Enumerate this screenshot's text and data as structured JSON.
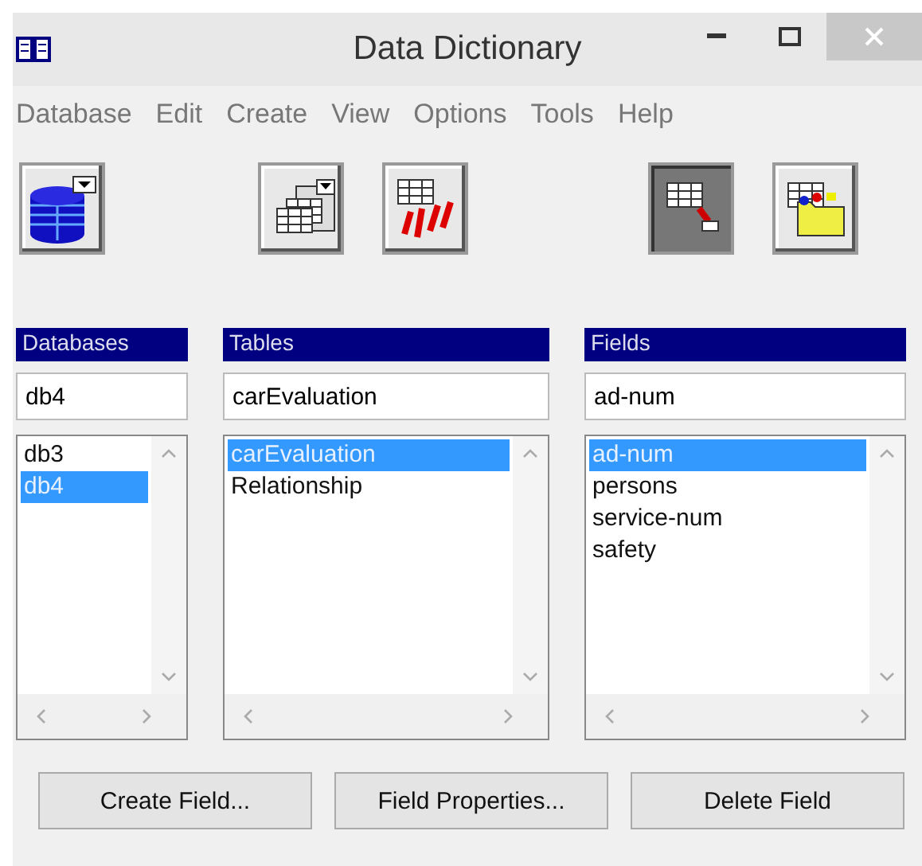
{
  "window": {
    "title": "Data Dictionary"
  },
  "menu": [
    "Database",
    "Edit",
    "Create",
    "View",
    "Options",
    "Tools",
    "Help"
  ],
  "toolbar": [
    [
      {
        "kind": "database",
        "pressed": false
      }
    ],
    [
      {
        "kind": "tables",
        "pressed": false
      },
      {
        "kind": "numbers",
        "pressed": false
      }
    ],
    [
      {
        "kind": "grid-link",
        "pressed": true
      },
      {
        "kind": "folder",
        "pressed": false
      }
    ]
  ],
  "panels": [
    {
      "title": "Databases",
      "value": "db4",
      "items": [
        {
          "label": "db3",
          "selected": false
        },
        {
          "label": "db4",
          "selected": true
        }
      ]
    },
    {
      "title": "Tables",
      "value": "carEvaluation",
      "items": [
        {
          "label": "carEvaluation",
          "selected": true
        },
        {
          "label": "Relationship",
          "selected": false
        }
      ]
    },
    {
      "title": "Fields",
      "value": "ad-num",
      "items": [
        {
          "label": "ad-num",
          "selected": true
        },
        {
          "label": "persons",
          "selected": false
        },
        {
          "label": "service-num",
          "selected": false
        },
        {
          "label": "safety",
          "selected": false
        }
      ]
    }
  ],
  "buttons": [
    "Create Field...",
    "Field Properties...",
    "Delete Field"
  ]
}
